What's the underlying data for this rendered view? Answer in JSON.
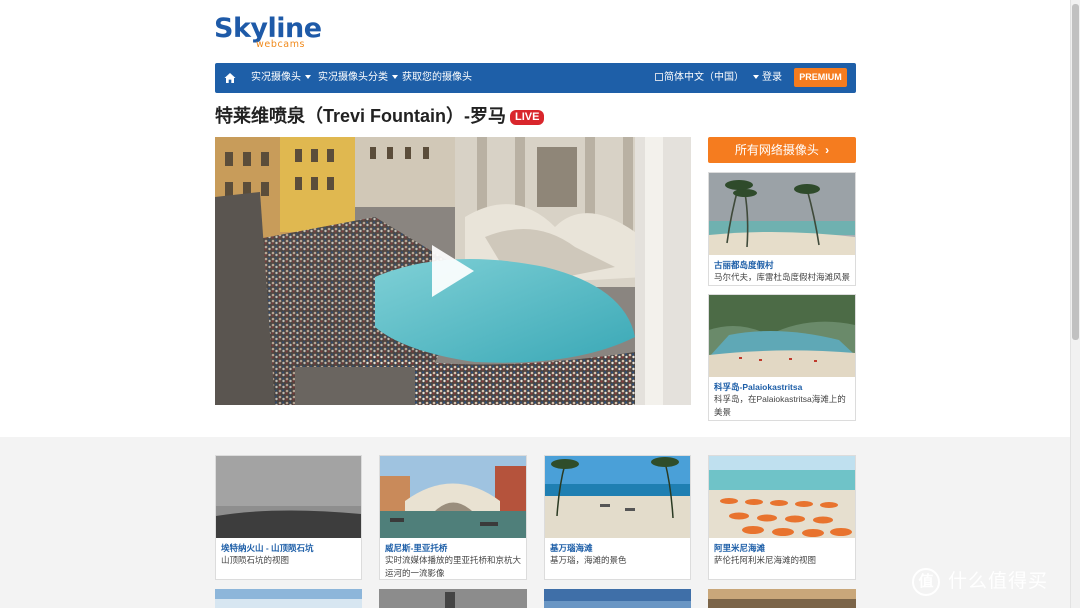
{
  "logo": {
    "word": "Skyline",
    "sub": "webcams"
  },
  "nav": {
    "items": [
      {
        "label": "实况摄像头",
        "caret": true
      },
      {
        "label": "实况摄像头分类",
        "caret": true
      },
      {
        "label": "获取您的摄像头",
        "caret": false
      }
    ],
    "language": "简体中文（中国）",
    "login": "登录",
    "premium": "PREMIUM"
  },
  "page": {
    "title": "特莱维喷泉（Trevi Fountain）-罗马",
    "live": "LIVE"
  },
  "sidebar": {
    "all_cams": "所有网络摄像头",
    "cards": [
      {
        "title": "古丽都岛度假村",
        "desc": "马尔代夫，库雷杜岛度假村海滩风景"
      },
      {
        "title": "科孚岛-Palaiokastritsa",
        "desc": "科孚岛，在Palaiokastritsa海滩上的美景"
      }
    ]
  },
  "grid": [
    {
      "title": "埃特纳火山 - 山顶陨石坑",
      "desc": "山顶陨石坑的视图"
    },
    {
      "title": "威尼斯-里亚托桥",
      "desc": "实时流媒体播放的里亚托桥和京杭大运河的一流影像"
    },
    {
      "title": "基万瑙海滩",
      "desc": "基万瑙，海滩的景色"
    },
    {
      "title": "阿里米尼海滩",
      "desc": "萨伦托阿利米尼海滩的视图"
    }
  ],
  "watermark": {
    "glyph": "值",
    "text": "什么值得买"
  },
  "colors": {
    "brand_blue": "#1e5fa8",
    "accent_orange": "#f57c1f",
    "live_red": "#d9262c"
  }
}
